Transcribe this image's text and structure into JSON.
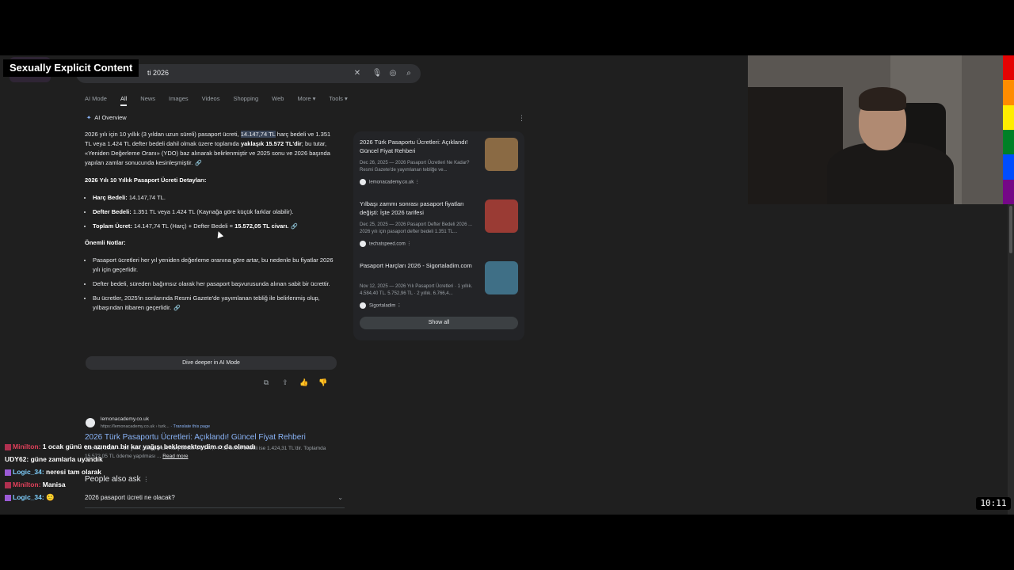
{
  "overlay": {
    "nsfw_label": "Sexually Explicit Content"
  },
  "search": {
    "query": "ti 2026"
  },
  "tabs": [
    "AI Mode",
    "All",
    "News",
    "Images",
    "Videos",
    "Shopping",
    "Web",
    "More ▾",
    "Tools ▾"
  ],
  "ai_overview": {
    "heading": "AI Overview",
    "intro_a": "2026 yılı için 10 yıllık (3 yıldan uzun süreli) pasaport ücreti, ",
    "intro_hl": "14.147,74 TL",
    "intro_b": " harç bedeli ve 1.351 TL veya 1.424 TL defter bedeli dahil olmak üzere toplamda ",
    "intro_bold": "yaklaşık 15.572 TL'dir",
    "intro_c": "; bu tutar, «Yeniden Değerleme Oranı» (YDO) baz alınarak belirlenmiştir ve 2025 sonu ve 2026 başında yapılan zamlar sonucunda kesinleşmiştir.",
    "details_heading": "2026 Yılı 10 Yıllık Pasaport Ücreti Detayları:",
    "d1_label": "Harç Bedeli:",
    "d1_text": " 14.147,74 TL.",
    "d2_label": "Defter Bedeli:",
    "d2_text": " 1.351 TL veya 1.424 TL (Kaynağa göre küçük farklar olabilir).",
    "d3_label": "Toplam Ücret:",
    "d3_text": " 14.147,74 TL (Harç) + Defter Bedeli = ",
    "d3_bold": "15.572,05 TL civarı.",
    "notes_heading": "Önemli Notlar:",
    "n1": "Pasaport ücretleri her yıl yeniden değerleme oranına göre artar, bu nedenle bu fiyatlar 2026 yılı için geçerlidir.",
    "n2": "Defter bedeli, süreden bağımsız olarak her pasaport başvurusunda alınan sabit bir ücrettir.",
    "n3": "Bu ücretler, 2025'in sonlarında Resmi Gazete'de yayımlanan tebliğ ile belirlenmiş olup, yılbaşından itibaren geçerlidir.",
    "dive_deeper": "Dive deeper in AI Mode"
  },
  "sources": [
    {
      "title": "2026 Türk Pasaportu Ücretleri: Açıklandı! Güncel Fiyat Rehberi",
      "desc": "Dec 26, 2025 — 2026 Pasaport Ücretleri Ne Kadar? Resmi Gazete'de yayımlanan tebliğe ve...",
      "site": "lemonacademy.co.uk",
      "thumb": "#8a6a44"
    },
    {
      "title": "Yılbaşı zammı sonrası pasaport fiyatları değişti: İşte 2026 tarifesi",
      "desc": "Dec 25, 2025 — 2026 Pasaport Defter Bedeli 2026 ... 2026 yılı için pasaport defter bedeli 1.351 TL...",
      "site": "techatspeed.com",
      "thumb": "#9a3b34"
    },
    {
      "title": "Pasaport Harçları 2026 - Sigortaladim.com",
      "desc": "Nov 12, 2025 — 2026 Yılı Pasaport Ücretleri · 1 yıllık. 4.584,40 TL. 5.752,96 TL · 2 yıllık. 6.766,4...",
      "site": "Sigortaladim",
      "thumb": "#3f6f86"
    }
  ],
  "show_all": "Show all",
  "result": {
    "site": "lemonacademy.co.uk",
    "url": "https://lemonacademy.co.uk › turk...",
    "translate": " · Translate this page",
    "title": "2026 Türk Pasaportu Ücretleri: Açıklandı! Güncel Fiyat Rehberi",
    "snippet": "Dec 26, 2025 — 10 yıllık pasaportun harç bedeli 14.147,74 TL, defter bedeli ise 1.424,31 TL'dir. Toplamda 15.572,05 TL ödeme yapılması ...",
    "read_more": "Read more"
  },
  "paa": {
    "heading": "People also ask",
    "q1": "2026 pasaport ücreti ne olacak?"
  },
  "chat": [
    {
      "user": "Minilton:",
      "msg": " 1 ocak günü en azından bir kar yağışı beklemekteydim o da olmadı"
    },
    {
      "user": "UDY62:",
      "msg": " güne zamlarla uyandık"
    },
    {
      "user": "Logic_34:",
      "msg": " neresi tam olarak"
    },
    {
      "user": "Minilton:",
      "msg": " Manisa"
    },
    {
      "user": "Logic_34:",
      "msg": " 🙂"
    }
  ],
  "clock": "10:11",
  "colors": {
    "accent": "#8ab4f8",
    "bg": "#1f1f1f"
  }
}
